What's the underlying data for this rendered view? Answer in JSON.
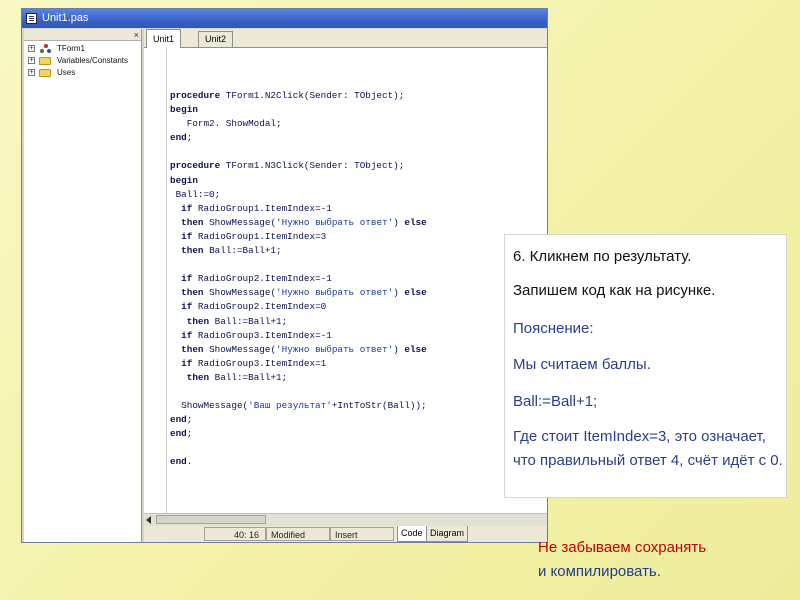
{
  "window": {
    "title": "Unit1.pas"
  },
  "explorer": {
    "close_glyph": "×",
    "items": [
      {
        "label": "TForm1",
        "expand": "+",
        "icon": "component-icon"
      },
      {
        "label": "Variables/Constants",
        "expand": "+",
        "icon": "folder-icon"
      },
      {
        "label": "Uses",
        "expand": "+",
        "icon": "folder-icon"
      }
    ]
  },
  "editor": {
    "tabs": [
      "Unit1",
      "Unit2"
    ],
    "active_tab": 0,
    "code_lines": [
      "procedure TForm1.N2Click(Sender: TObject);",
      "begin",
      "   Form2. ShowModal;",
      "end;",
      "",
      "procedure TForm1.N3Click(Sender: TObject);",
      "begin",
      " Ball:=0;",
      "  if RadioGroup1.ItemIndex=-1",
      "  then ShowMessage('Нужно выбрать ответ') else",
      "  if RadioGroup1.ItemIndex=3",
      "  then Ball:=Ball+1;",
      "",
      "  if RadioGroup2.ItemIndex=-1",
      "  then ShowMessage('Нужно выбрать ответ') else",
      "  if RadioGroup2.ItemIndex=0",
      "   then Ball:=Ball+1;",
      "  if RadioGroup3.ItemIndex=-1",
      "  then ShowMessage('Нужно выбрать ответ') else",
      "  if RadioGroup3.ItemIndex=1",
      "   then Ball:=Ball+1;",
      "",
      "  ShowMessage('Ваш результат'+IntToStr(Ball));",
      "end;",
      "end;",
      "",
      "end."
    ]
  },
  "status": {
    "position": "40: 16",
    "state": "Modified",
    "mode": "Insert",
    "bottom_tabs": [
      "Code",
      "Diagram"
    ]
  },
  "note": {
    "step": "6. Кликнем по результату.",
    "instruction": "Запишем код как на рисунке.",
    "explain_label": "Пояснение:",
    "line1": "Мы считаем баллы.",
    "line2": "Ball:=Ball+1;",
    "line3": "Где стоит ItemIndex=3, это означает, что правильный ответ 4, счёт идёт с 0."
  },
  "reminder": {
    "line1": "Не забываем сохранять",
    "line2": "и компилировать."
  },
  "colors": {
    "slide_background": "#f7f6b5",
    "title_bar": "#3a64c8",
    "reminder_text": "#c00000"
  }
}
